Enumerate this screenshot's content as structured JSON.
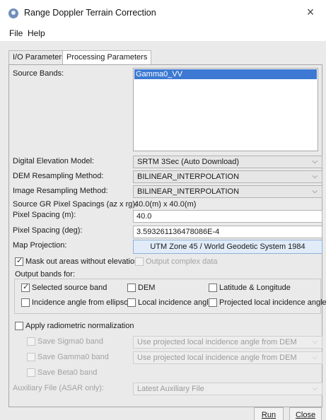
{
  "window": {
    "title": "Range Doppler Terrain Correction",
    "close_glyph": "×"
  },
  "menu": {
    "items": [
      "File",
      "Help"
    ]
  },
  "tabs": [
    {
      "label": "I/O Parameters",
      "active": false
    },
    {
      "label": "Processing Parameters",
      "active": true
    }
  ],
  "params": {
    "source_bands_label": "Source Bands:",
    "source_bands": [
      "Gamma0_VV"
    ],
    "dem_label": "Digital Elevation Model:",
    "dem_value": "SRTM 3Sec (Auto Download)",
    "dem_resampling_label": "DEM Resampling Method:",
    "dem_resampling_value": "BILINEAR_INTERPOLATION",
    "img_resampling_label": "Image Resampling Method:",
    "img_resampling_value": "BILINEAR_INTERPOLATION",
    "gr_spacing_label": "Source GR Pixel Spacings (az x rg):",
    "gr_spacing_value": "40.0(m) x 40.0(m)",
    "pixel_spacing_m_label": "Pixel Spacing (m):",
    "pixel_spacing_m_value": "40.0",
    "pixel_spacing_deg_label": "Pixel Spacing (deg):",
    "pixel_spacing_deg_value": "3.593261136478086E-4",
    "map_projection_label": "Map Projection:",
    "map_projection_value": "UTM Zone 45 / World Geodetic System 1984"
  },
  "options": {
    "mask_out": {
      "label": "Mask out areas without elevation",
      "checked": true
    },
    "output_complex": {
      "label": "Output complex data",
      "checked": false
    }
  },
  "output_bands": {
    "title": "Output bands for:",
    "selected_source_band": {
      "label": "Selected source band",
      "checked": true
    },
    "dem": {
      "label": "DEM",
      "checked": false
    },
    "lat_long": {
      "label": "Latitude & Longitude",
      "checked": false
    },
    "incidence_ellipsoid": {
      "label": "Incidence angle from ellipsoid",
      "checked": false
    },
    "local_incidence": {
      "label": "Local incidence angle",
      "checked": false
    },
    "projected_local_incidence": {
      "label": "Projected local incidence angle",
      "checked": false
    }
  },
  "radiometric": {
    "apply": {
      "label": "Apply radiometric normalization",
      "checked": false
    },
    "save_sigma0": {
      "label": "Save Sigma0 band",
      "combo": "Use projected local incidence angle from DEM"
    },
    "save_gamma0": {
      "label": "Save Gamma0 band",
      "combo": "Use projected local incidence angle from DEM"
    },
    "save_beta0": {
      "label": "Save Beta0 band"
    },
    "aux_label": "Auxiliary File (ASAR only):",
    "aux_value": "Latest Auxiliary File"
  },
  "footer": {
    "run_label": "Run",
    "close_label": "Close"
  },
  "icons": {
    "dropdown": "chevron-down-icon",
    "app": "app-icon",
    "close": "close-icon"
  },
  "colors": {
    "selection": "#3d79d3",
    "panel_bg": "#eaeaea",
    "button_accent": "#e1ecf8"
  }
}
